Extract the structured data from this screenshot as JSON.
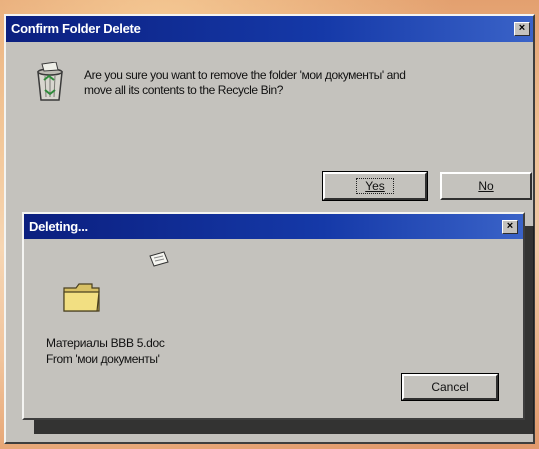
{
  "confirm_dialog": {
    "title": "Confirm Folder Delete",
    "close_glyph": "×",
    "message_line1": "Are you sure you want to remove the folder 'мои документы' and",
    "message_line2": "move all its contents to the Recycle Bin?",
    "yes_label": "Yes",
    "no_label": "No",
    "icon": "recycle-bin-icon"
  },
  "deleting_dialog": {
    "title": "Deleting...",
    "close_glyph": "×",
    "file_name": "Материалы BBB 5.doc",
    "from_text": "From 'мои документы'",
    "cancel_label": "Cancel",
    "icons": [
      "flying-paper-icon",
      "folder-icon"
    ]
  },
  "colors": {
    "titlebar_start": "#0b1f7f",
    "titlebar_end": "#3a63c8",
    "dialog_face": "#c4c2bd",
    "folder_yellow": "#f2df82"
  }
}
